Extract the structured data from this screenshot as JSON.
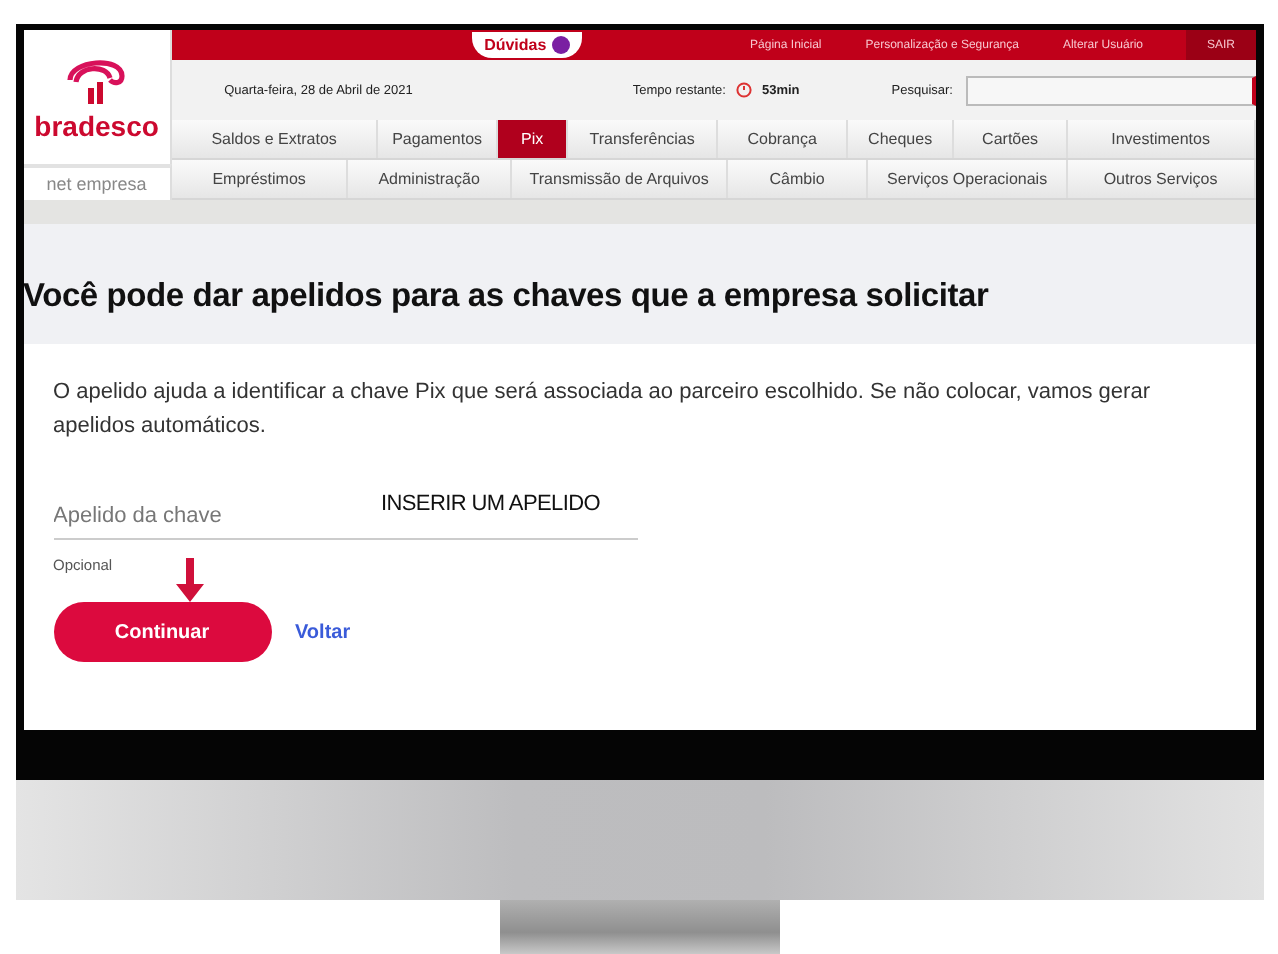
{
  "top_bar": {
    "help": "Dúvidas",
    "links": [
      "Página Inicial",
      "Personalização e Segurança",
      "Alterar Usuário"
    ],
    "logout": "SAIR"
  },
  "logo": {
    "name": "bradesco",
    "subtitle": "net empresa"
  },
  "info_bar": {
    "date": "Quarta-feira, 28 de Abril de 2021",
    "time_label": "Tempo restante:",
    "time_value": "53min",
    "search_label": "Pesquisar:"
  },
  "nav_rows": [
    {
      "items": [
        {
          "label": "Saldos e Extratos",
          "selected": false
        },
        {
          "label": "Pagamentos",
          "selected": false
        },
        {
          "label": "Pix",
          "selected": true
        },
        {
          "label": "Transferências",
          "selected": false
        },
        {
          "label": "Cobrança",
          "selected": false
        },
        {
          "label": "Cheques",
          "selected": false
        },
        {
          "label": "Cartões",
          "selected": false
        },
        {
          "label": "Investimentos",
          "selected": false
        }
      ]
    },
    {
      "items": [
        {
          "label": "Empréstimos",
          "selected": false
        },
        {
          "label": "Administração",
          "selected": false
        },
        {
          "label": "Transmissão de Arquivos",
          "selected": false
        },
        {
          "label": "Câmbio",
          "selected": false
        },
        {
          "label": "Serviços Operacionais",
          "selected": false
        },
        {
          "label": "Outros Serviços",
          "selected": false
        }
      ]
    }
  ],
  "heading": "Você pode dar apelidos para as chaves que a empresa solicitar",
  "description": "O apelido ajuda a identificar a chave Pix que será associada ao parceiro escolhido. Se não colocar, vamos gerar apelidos automáticos.",
  "field": {
    "placeholder": "Apelido da chave",
    "hint": "Opcional"
  },
  "annotation": "INSERIR UM APELIDO",
  "buttons": [
    {
      "label": "Continuar",
      "kind": "primary"
    },
    {
      "label": "Voltar",
      "kind": "link"
    }
  ]
}
